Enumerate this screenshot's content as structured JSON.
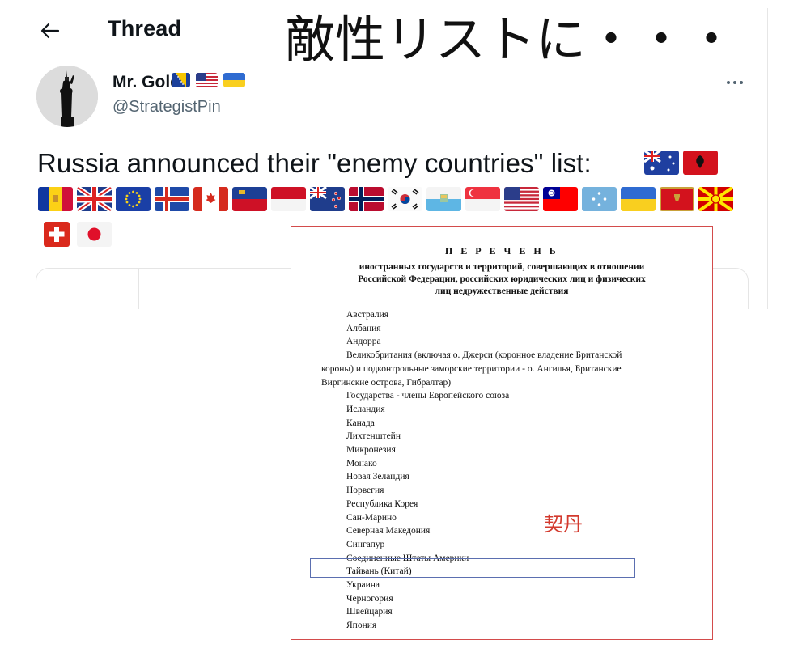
{
  "header": {
    "title": "Thread",
    "back_icon": "arrow-left-icon"
  },
  "overlay_caption": "敵性リストに・・・",
  "author": {
    "name": "Mr. Gold",
    "handle": "@StrategistPin",
    "name_flags": [
      "Bosnia and Herzegovina",
      "United States",
      "Ukraine"
    ],
    "avatar_icon": "statue-of-liberty-avatar"
  },
  "tweet": {
    "text": "Russia announced their \"enemy countries\" list:",
    "flags_row0": [
      "Australia",
      "Albania"
    ],
    "flags_row1": [
      "Andorra",
      "United Kingdom",
      "European Union",
      "Iceland",
      "Canada",
      "Liechtenstein",
      "Monaco",
      "New Zealand",
      "Norway",
      "South Korea",
      "San Marino",
      "Singapore",
      "United States",
      "Taiwan",
      "Micronesia",
      "Ukraine",
      "Montenegro",
      "North Macedonia"
    ],
    "flags_row2": [
      "Switzerland",
      "Japan"
    ]
  },
  "document": {
    "title": "П Е Р Е Ч Е Н Ь",
    "subtitle_lines": [
      "иностранных государств и территорий, совершающих в отношении",
      "Российской Федерации, российских юридических лиц и физических",
      "лиц недружественные действия"
    ],
    "items": [
      "Австралия",
      "Албания",
      "Андорра",
      "Великобритания (включая о. Джерси (коронное владение Британской",
      "Государства - члены Европейского союза",
      "Исландия",
      "Канада",
      "Лихтенштейн",
      "Микронезия",
      "Монако",
      "Новая Зеландия",
      "Норвегия",
      "Республика Корея",
      "Сан-Марино",
      "Северная Македония",
      "Сингапур",
      "Соединенные Штаты Америки",
      "Тайвань (Китай)",
      "Украина",
      "Черногория",
      "Швейцария",
      "Япония"
    ],
    "uk_continuation": [
      "короны) и подконтрольные заморские территории - о. Ангилья, Британские",
      "Виргинские острова, Гибралтар)"
    ]
  },
  "annotation": {
    "text": "契丹",
    "highlighted_item": "Тайвань (Китай)"
  },
  "colors": {
    "accent_red": "#d33a2e",
    "border_red": "#d34b4b",
    "highlight_blue": "#5b6fb0",
    "muted": "#536471"
  }
}
